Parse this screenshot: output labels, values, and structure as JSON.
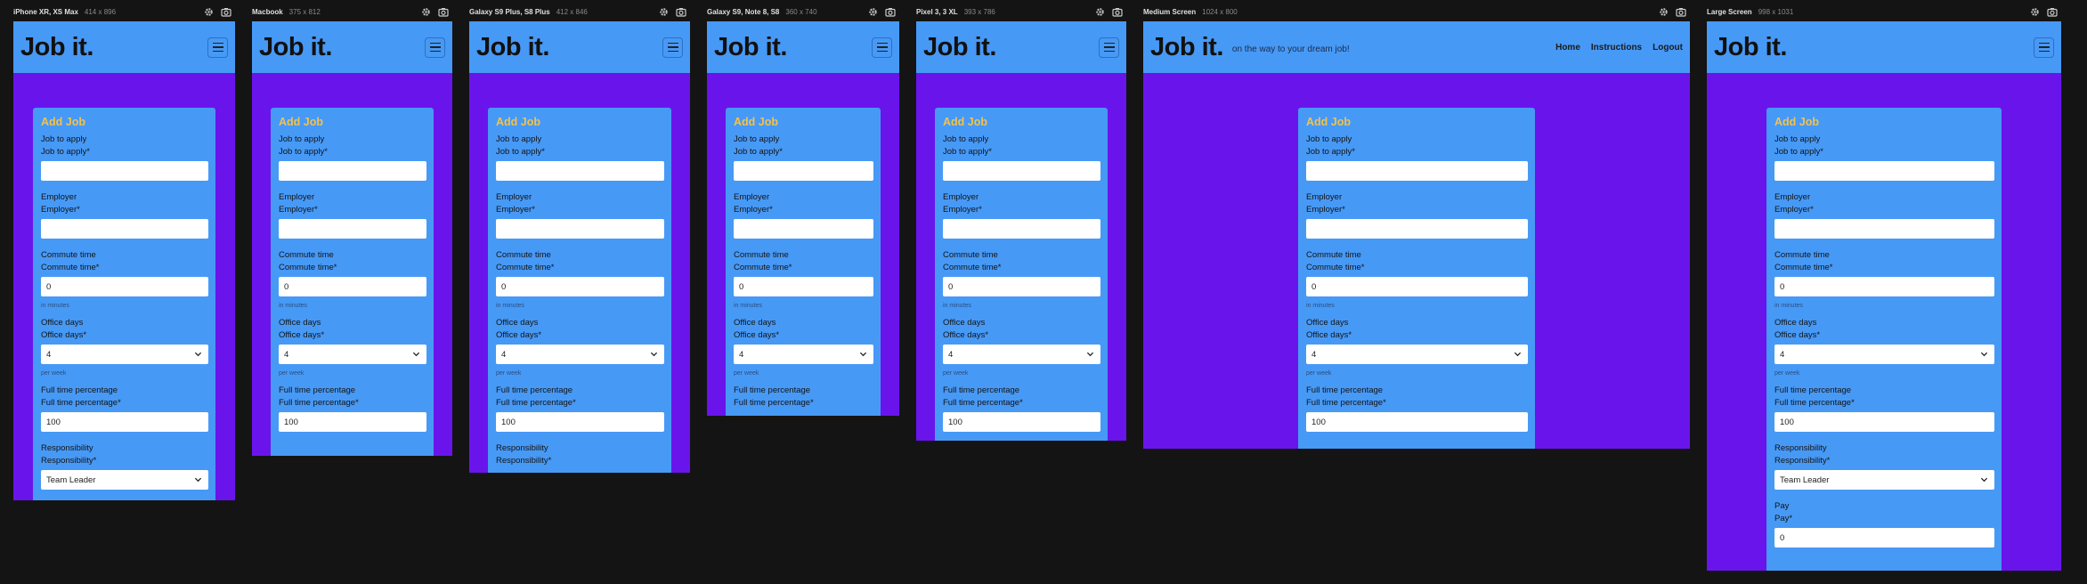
{
  "app": {
    "logo": "Job it.",
    "tagline": "on the way to your dream job!",
    "nav": [
      "Home",
      "Instructions",
      "Logout"
    ]
  },
  "devices": [
    {
      "name": "iPhone XR, XS Max",
      "size": "414 x 896"
    },
    {
      "name": "Macbook",
      "size": "375 x 812"
    },
    {
      "name": "Galaxy S9 Plus, S8 Plus",
      "size": "412 x 846"
    },
    {
      "name": "Galaxy S9, Note 8, S8",
      "size": "360 x 740"
    },
    {
      "name": "Pixel 3, 3 XL",
      "size": "393 x 786"
    },
    {
      "name": "Medium Screen",
      "size": "1024 x 800"
    },
    {
      "name": "Large Screen",
      "size": "998 x 1031"
    }
  ],
  "form": {
    "title": "Add Job",
    "job": {
      "label": "Job to apply",
      "label_req": "Job to apply*",
      "value": ""
    },
    "employer": {
      "label": "Employer",
      "label_req": "Employer*",
      "value": ""
    },
    "commute": {
      "label": "Commute time",
      "label_req": "Commute time*",
      "value": "0",
      "hint": "in minutes"
    },
    "office": {
      "label": "Office days",
      "label_req": "Office days*",
      "value": "4",
      "hint": "per week"
    },
    "fulltime": {
      "label": "Full time percentage",
      "label_req": "Full time percentage*",
      "value": "100"
    },
    "resp": {
      "label": "Responsibility",
      "label_req": "Responsibility*",
      "value": "Team Leader"
    },
    "pay": {
      "label": "Pay",
      "label_req": "Pay*",
      "value": "0"
    }
  },
  "icons": [
    "gear-icon",
    "camera-icon",
    "hamburger-icon",
    "chevron-down-icon"
  ],
  "colors": {
    "header": "#4799f6",
    "page": "#6a14ec",
    "title": "#f3c24a",
    "background": "#141414"
  }
}
